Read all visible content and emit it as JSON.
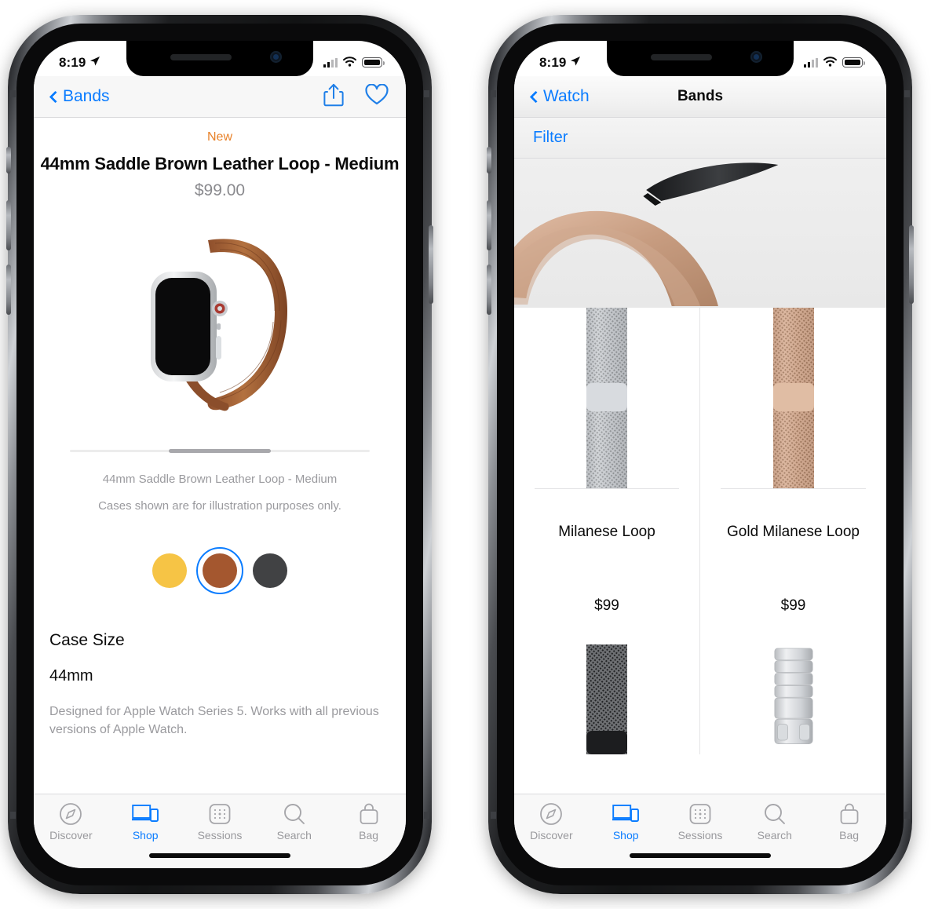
{
  "status_bar": {
    "time": "8:19",
    "location_icon": "location-arrow-icon",
    "cellular_icon": "cellular-signal-icon",
    "wifi_icon": "wifi-icon",
    "battery_icon": "battery-icon"
  },
  "left_phone": {
    "nav": {
      "back_label": "Bands",
      "back_icon": "chevron-left-icon",
      "share_icon": "share-icon",
      "favorite_icon": "heart-icon"
    },
    "product": {
      "badge": "New",
      "title": "44mm Saddle Brown Leather Loop - Medium",
      "price": "$99.00",
      "image_alt": "apple-watch-saddle-brown-leather-loop",
      "caption_line1": "44mm Saddle Brown Leather Loop - Medium",
      "caption_line2": "Cases shown are for illustration purposes only.",
      "colors": [
        {
          "name": "gold",
          "hex": "#f5c council",
          "value": "#f6c council"
        },
        {
          "name": "saddle-brown",
          "value": "#a05a36"
        },
        {
          "name": "space-gray",
          "value": "#3f4042"
        }
      ],
      "color_swatches": [
        {
          "name": "gold-swatch",
          "hex": "#f6c445",
          "selected": false
        },
        {
          "name": "saddle-brown-swatch",
          "hex": "#a4572f",
          "selected": true
        },
        {
          "name": "black-swatch",
          "hex": "#414244",
          "selected": false
        }
      ],
      "section_title": "Case Size",
      "section_value": "44mm",
      "section_note": "Designed for Apple Watch Series 5. Works with all previous versions of Apple Watch."
    }
  },
  "right_phone": {
    "nav": {
      "back_label": "Watch",
      "back_icon": "chevron-left-icon",
      "title": "Bands"
    },
    "filter_label": "Filter",
    "banner_alt": "milanese-loop-banner",
    "products": [
      {
        "name": "Milanese Loop",
        "price": "$99",
        "image": "silver-milanese-loop",
        "mesh": "#b9bcc0",
        "clasp": "#d7dade"
      },
      {
        "name": "Gold Milanese Loop",
        "price": "$99",
        "image": "gold-milanese-loop",
        "mesh": "#c9a088",
        "clasp": "#dcb69c"
      },
      {
        "name": "",
        "price": "",
        "image": "space-black-milanese-loop",
        "mesh": "#4a4b4d",
        "clasp": "#262728"
      },
      {
        "name": "",
        "price": "",
        "image": "silver-link-bracelet",
        "mesh": "#c6c9cd",
        "clasp": "#d8dbdf"
      }
    ]
  },
  "tab_bar": {
    "tabs": [
      {
        "label": "Discover",
        "icon": "compass-icon",
        "active": false
      },
      {
        "label": "Shop",
        "icon": "devices-icon",
        "active": true
      },
      {
        "label": "Sessions",
        "icon": "calendar-grid-icon",
        "active": false
      },
      {
        "label": "Search",
        "icon": "search-icon",
        "active": false
      },
      {
        "label": "Bag",
        "icon": "bag-icon",
        "active": false
      }
    ]
  },
  "colors": {
    "accent_blue": "#0a7cff",
    "new_orange": "#e8822a",
    "muted_gray": "#9a9a9e"
  }
}
